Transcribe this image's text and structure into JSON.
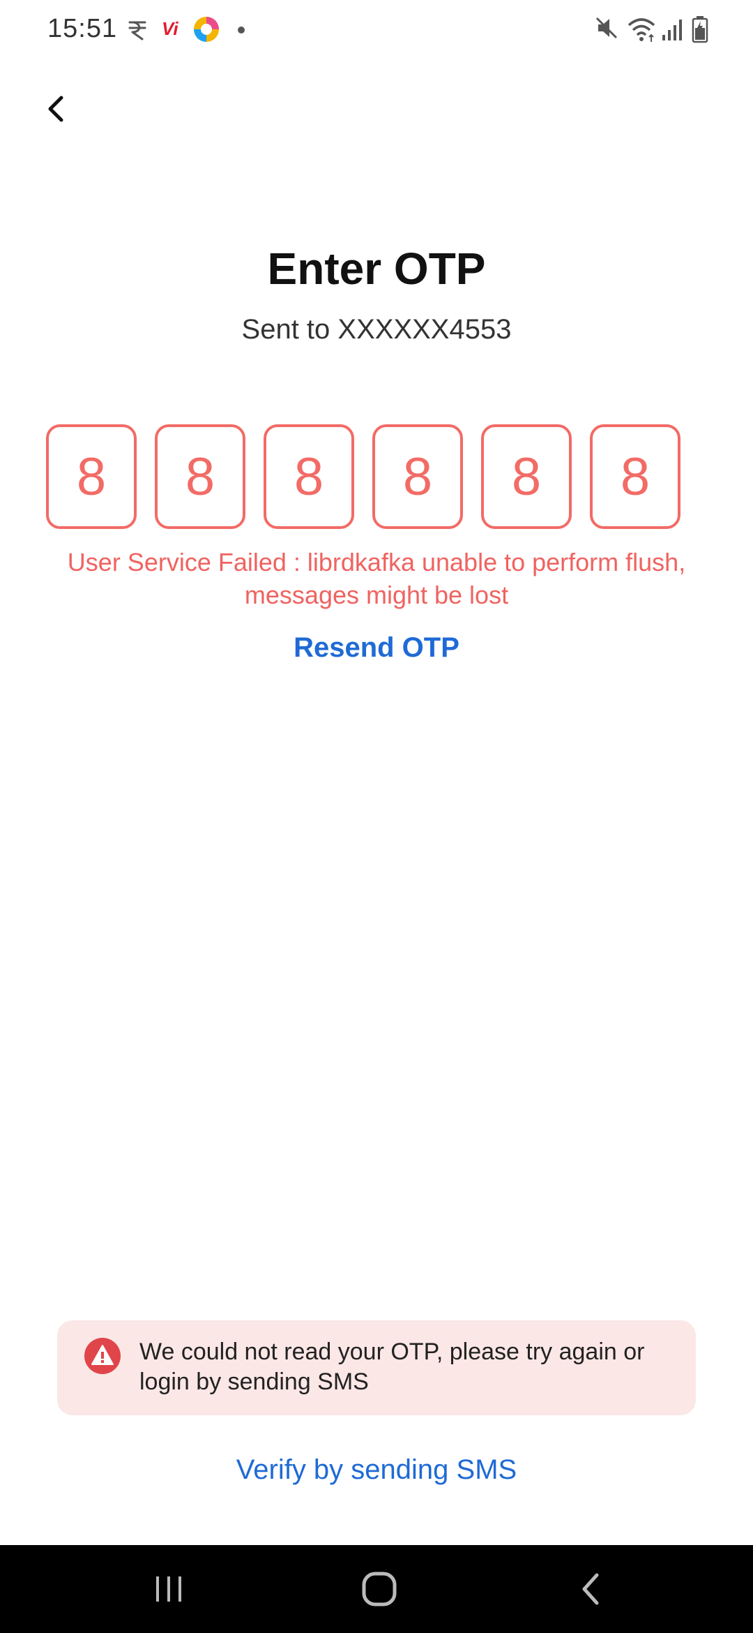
{
  "status_bar": {
    "time": "15:51",
    "icons": [
      "rupee-icon",
      "vi-carrier-icon",
      "colorful-app-icon",
      "dot-icon",
      "mute-icon",
      "wifi-icon",
      "signal-icon",
      "battery-icon"
    ],
    "vi_label": "Vi"
  },
  "header": {
    "back_icon": "back-arrow-icon"
  },
  "main": {
    "title": "Enter OTP",
    "subtitle": "Sent to XXXXXX4553",
    "otp_digits": [
      "8",
      "8",
      "8",
      "8",
      "8",
      "8"
    ],
    "error_message": "User Service Failed : librdkafka unable to perform flush, messages might be lost",
    "resend_label": "Resend OTP"
  },
  "alert": {
    "icon": "warning-icon",
    "message": "We could not read your OTP, please try again or login by sending SMS"
  },
  "footer": {
    "verify_sms_label": "Verify by sending SMS"
  },
  "nav_bar": {
    "recents_icon": "recents-icon",
    "home_icon": "home-icon",
    "back_icon": "nav-back-icon"
  },
  "colors": {
    "error": "#f26b66",
    "link": "#1f6ad6",
    "alert_bg": "#fbe7e6",
    "alert_icon": "#e0454a"
  }
}
